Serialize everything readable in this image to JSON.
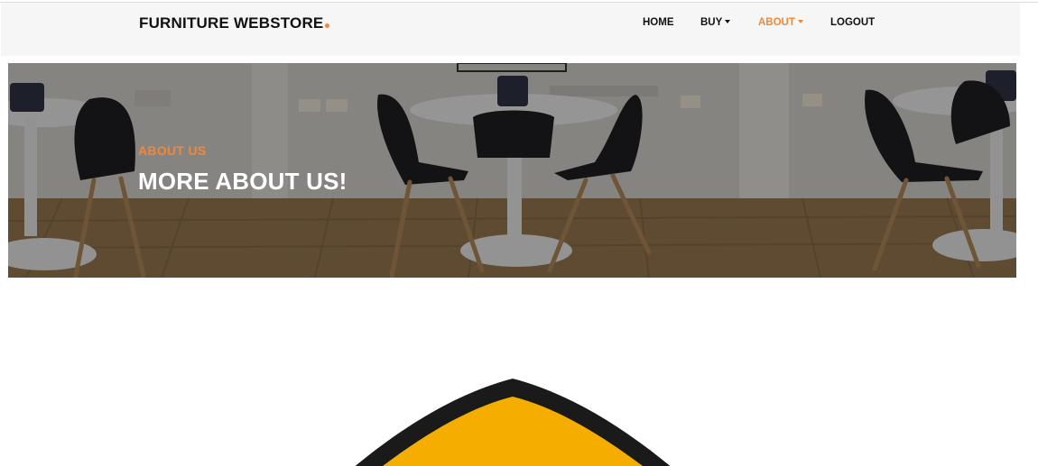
{
  "brand": {
    "name": "FURNITURE WEBSTORE",
    "dot_color": "#f0883a"
  },
  "nav": {
    "home": "HOME",
    "buy": "BUY",
    "about": "ABOUT",
    "logout": "LOGOUT",
    "active_color": "#f0883a"
  },
  "hero": {
    "kicker": "ABOUT US",
    "title": "MORE ABOUT US!",
    "kicker_color": "#f0883a"
  },
  "logo": {
    "fill_color": "#f5ae00",
    "outline_color": "#1a1a1a"
  }
}
